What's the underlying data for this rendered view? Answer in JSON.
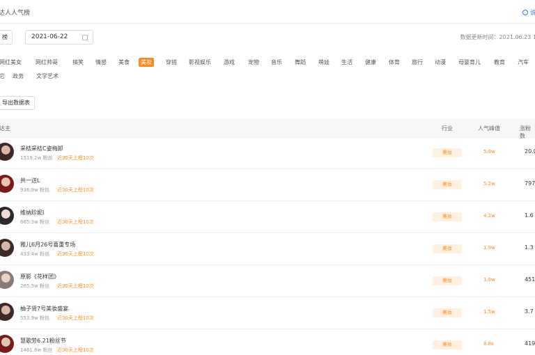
{
  "header": {
    "title": "达人人气榜",
    "help_label": "说"
  },
  "filter": {
    "left_button": "榜",
    "date": "2021-06-22",
    "update_time": "数据更新时间：2021.06.23 1"
  },
  "categories": [
    {
      "label": "网红美女",
      "active": false
    },
    {
      "label": "网红帅哥",
      "active": false
    },
    {
      "label": "搞笑",
      "active": false
    },
    {
      "label": "情感",
      "active": false
    },
    {
      "label": "美食",
      "active": false
    },
    {
      "label": "美妆",
      "active": true
    },
    {
      "label": "穿搭",
      "active": false
    },
    {
      "label": "影视娱乐",
      "active": false
    },
    {
      "label": "游戏",
      "active": false
    },
    {
      "label": "宠物",
      "active": false
    },
    {
      "label": "音乐",
      "active": false
    },
    {
      "label": "舞蹈",
      "active": false
    },
    {
      "label": "萌娃",
      "active": false
    },
    {
      "label": "生活",
      "active": false
    },
    {
      "label": "健康",
      "active": false
    },
    {
      "label": "体育",
      "active": false
    },
    {
      "label": "旅行",
      "active": false
    },
    {
      "label": "动漫",
      "active": false
    },
    {
      "label": "母婴育儿",
      "active": false
    },
    {
      "label": "教育",
      "active": false
    },
    {
      "label": "汽车",
      "active": false
    },
    {
      "label": "它",
      "active": false
    },
    {
      "label": "政务",
      "active": false
    },
    {
      "label": "文学艺术",
      "active": false
    }
  ],
  "export_button": "导出数据表",
  "table": {
    "headers": {
      "creator": "达主",
      "industry": "行业",
      "popularity": "人气峰值",
      "last": "涨粉数"
    },
    "rows": [
      {
        "name": "采桔采桔C姿梅卸",
        "fans": "1519.2w 粉丝",
        "tag": "近30天上榜10次",
        "industry": "美妆",
        "pop": "5.9w",
        "last": "20.0"
      },
      {
        "name": "共一送L",
        "fans": "936.9w 粉丝",
        "tag": "近30天上榜10次",
        "industry": "美妆",
        "pop": "5.2w",
        "last": "797"
      },
      {
        "name": "维纳珍妮I",
        "fans": "665.3w 粉丝",
        "tag": "近30天上榜10次",
        "industry": "美妆",
        "pop": "4.2w",
        "last": "1.6"
      },
      {
        "name": "雅儿6月26号喜重专场",
        "fans": "433.4w 粉丝",
        "tag": "近30天上榜10次",
        "industry": "美妆",
        "pop": "1.9w",
        "last": "1.3"
      },
      {
        "name": "原影《花样团》",
        "fans": "265.5w 粉丝",
        "tag": "近30天上榜10次",
        "industry": "美妆",
        "pop": "1.9w",
        "last": "451"
      },
      {
        "name": "柚子贤7号美妆盛宴",
        "fans": "553.9w 粉丝",
        "tag": "近30天上榜10次",
        "industry": "美妆",
        "pop": "1.5w",
        "last": "3.7"
      },
      {
        "name": "慧歌劳6.21粉丝节",
        "fans": "1461.6w 粉丝",
        "tag": "近30天上榜10次",
        "industry": "美妆",
        "pop": "8.8k",
        "last": "419"
      }
    ]
  }
}
